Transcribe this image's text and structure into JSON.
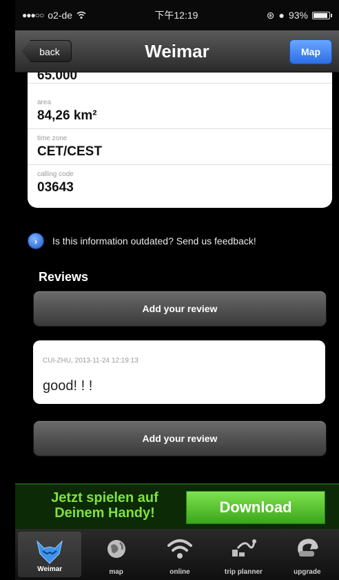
{
  "status_bar": {
    "signal": "●●●○○",
    "carrier": "o2-de",
    "time": "下午12:19",
    "battery": "93%",
    "battery_level": 0.93
  },
  "nav": {
    "back_label": "back",
    "title": "Weimar",
    "map_label": "Map"
  },
  "info": {
    "population_value": "65.000",
    "area_label": "area",
    "area_value": "84,26 km²",
    "timezone_label": "time zone",
    "timezone_value": "CET/CEST",
    "calling_code_label": "calling code",
    "calling_code_value": "03643"
  },
  "feedback": {
    "text": "Is this information outdated? Send us feedback!"
  },
  "reviews": {
    "heading": "Reviews",
    "add_button_top": "Add your review",
    "add_button_bottom": "Add your review",
    "items": [
      {
        "meta": "CUI-ZHU, 2013-11-24 12:19:13",
        "text": "good! ! !"
      }
    ]
  },
  "ad": {
    "text_line1": "Jetzt spielen auf",
    "text_line2": "Deinem Handy!",
    "download_label": "Download"
  },
  "tabs": [
    {
      "label": "Weimar",
      "icon": "fox-icon",
      "active": true
    },
    {
      "label": "map",
      "icon": "globe-icon",
      "active": false
    },
    {
      "label": "online",
      "icon": "wifi-icon",
      "active": false
    },
    {
      "label": "trip planner",
      "icon": "route-icon",
      "active": false
    },
    {
      "label": "upgrade",
      "icon": "refresh-icon",
      "active": false
    }
  ],
  "colors": {
    "accent_blue": "#2c6fe6",
    "ad_green": "#7fe23b"
  }
}
